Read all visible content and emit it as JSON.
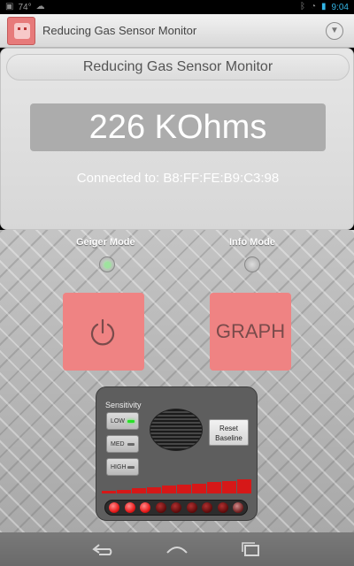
{
  "status_bar": {
    "temperature": "74°",
    "time": "9:04"
  },
  "action_bar": {
    "title": "Reducing Gas Sensor Monitor"
  },
  "monitor": {
    "header": "Reducing Gas Sensor Monitor",
    "reading": "226 KOhms",
    "connection": "Connected to: B8:FF:FE:B9:C3:98"
  },
  "modes": {
    "geiger_label": "Geiger Mode",
    "geiger_selected": true,
    "info_label": "Info Mode",
    "info_selected": false
  },
  "buttons": {
    "graph_label": "GRAPH"
  },
  "sensitivity": {
    "title": "Sensitivity",
    "levels": [
      {
        "label": "LOW",
        "active": true
      },
      {
        "label": "MED",
        "active": false
      },
      {
        "label": "HIGH",
        "active": false
      }
    ],
    "reset_label": "Reset Baseline",
    "meter_segments_lit": 10,
    "meter_segments_total": 10,
    "led_count": 9,
    "leds_bright": 3
  },
  "colors": {
    "accent": "#33b5e5",
    "button_pink": "#ef8383",
    "led_red": "#e81c1c"
  }
}
